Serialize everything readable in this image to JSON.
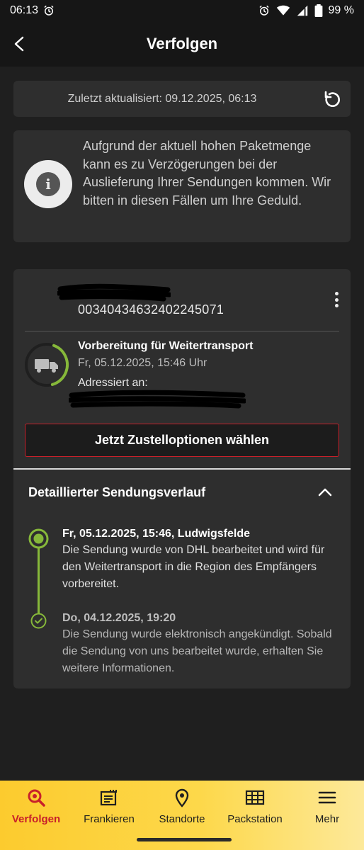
{
  "status_bar": {
    "time": "06:13",
    "battery": "99 %"
  },
  "header": {
    "title": "Verfolgen",
    "back_icon": "back-arrow-icon"
  },
  "update": {
    "text": "Zuletzt aktualisiert: 09.12.2025, 06:13",
    "refresh_icon": "refresh-icon"
  },
  "info": {
    "text": "Aufgrund der aktuell hohen Paketmenge kann es zu Verzögerungen bei der Auslieferung Ihrer Sendungen kommen. Wir bitten in diesen Fällen um Ihre Geduld."
  },
  "shipment": {
    "tracking_number": "00340434632402245071",
    "status_title": "Vorbereitung für Weitertransport",
    "status_date": "Fr, 05.12.2025, 15:46 Uhr",
    "addressed_label": "Adressiert an:",
    "progress_fraction": 0.4,
    "cta_label": "Jetzt Zustelloptionen wählen"
  },
  "history": {
    "title": "Detaillierter Sendungsverlauf",
    "events": [
      {
        "title": "Fr, 05.12.2025, 15:46, Ludwigsfelde",
        "text": "Die Sendung wurde von DHL bearbeitet und wird für den Weitertransport in die Region des Empfängers vorbereitet."
      },
      {
        "title": "Do, 04.12.2025, 19:20",
        "text": "Die Sendung wurde elektronisch angekündigt. Sobald die Sendung von uns bearbeitet wurde, erhalten Sie weitere Informationen."
      }
    ]
  },
  "nav": {
    "items": [
      {
        "label": "Verfolgen",
        "icon": "search-icon",
        "active": true
      },
      {
        "label": "Frankieren",
        "icon": "stamp-icon"
      },
      {
        "label": "Standorte",
        "icon": "location-pin-icon"
      },
      {
        "label": "Packstation",
        "icon": "packstation-icon"
      },
      {
        "label": "Mehr",
        "icon": "menu-icon"
      }
    ]
  },
  "colors": {
    "accent_red": "#c8202a",
    "accent_yellow": "#fccb2e",
    "progress_green": "#86b83a"
  }
}
